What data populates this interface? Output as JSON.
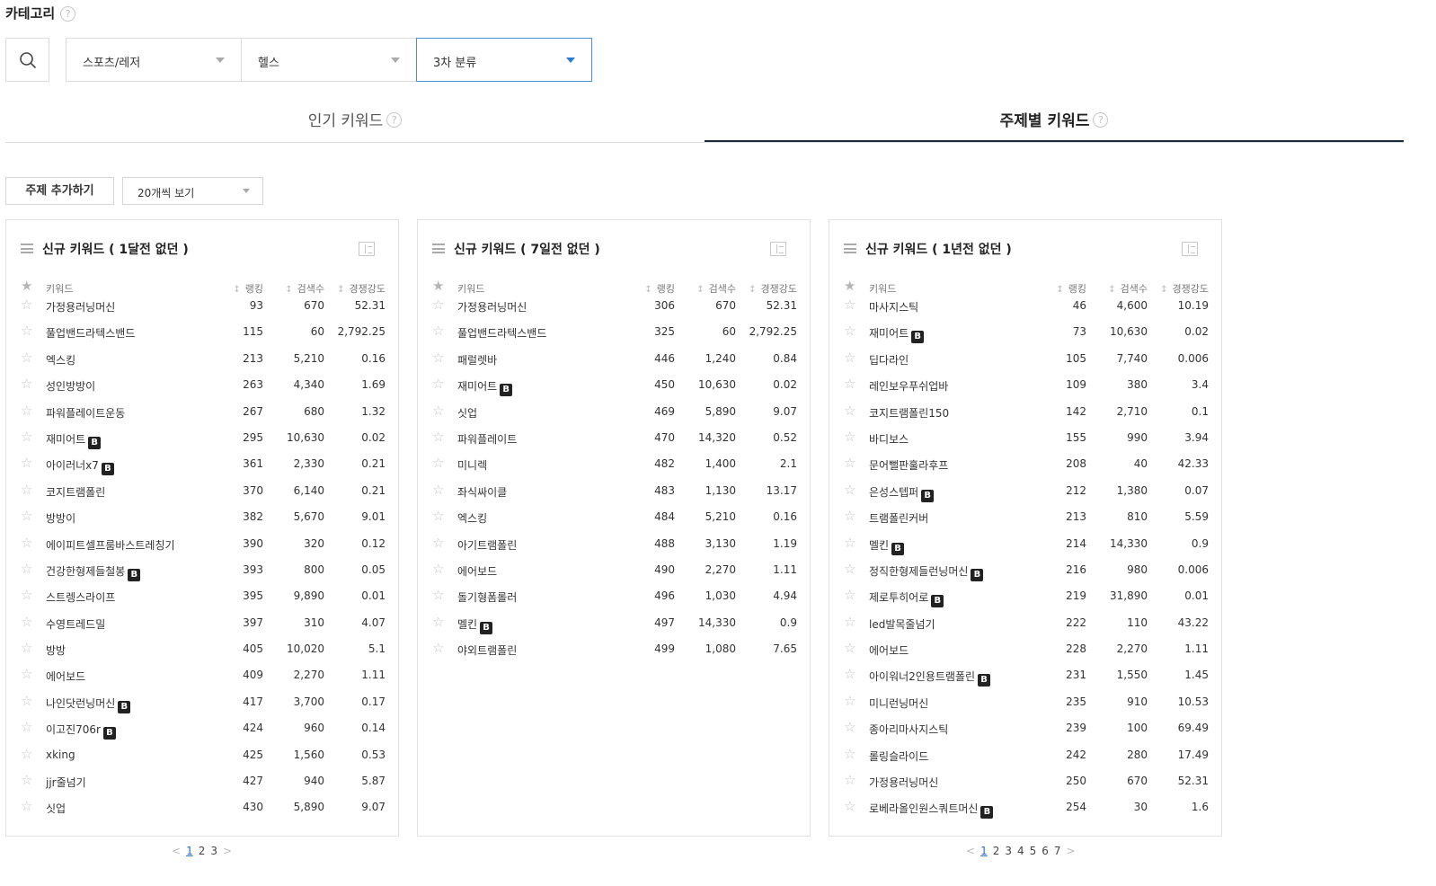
{
  "category": {
    "title": "카테고리",
    "help": "?"
  },
  "filters": {
    "first": "스포츠/레저",
    "second": "헬스",
    "third": "3차 분류"
  },
  "tabs": [
    {
      "label": "인기 키워드",
      "active": false
    },
    {
      "label": "주제별 키워드",
      "active": true
    }
  ],
  "toolbar": {
    "add_topic": "주제 추가하기",
    "view_count": "20개씩 보기"
  },
  "columns": {
    "keyword": "키워드",
    "rank": "랭킹",
    "search": "검색수",
    "competition": "경쟁강도"
  },
  "panels": [
    {
      "title": "신규 키워드 ( 1달전 없던 )",
      "rows": [
        {
          "kw": "가정용러닝머신",
          "b": false,
          "rank": "93",
          "search": "670",
          "comp": "52.31"
        },
        {
          "kw": "풀업밴드라텍스밴드",
          "b": false,
          "rank": "115",
          "search": "60",
          "comp": "2,792.25"
        },
        {
          "kw": "엑스킹",
          "b": false,
          "rank": "213",
          "search": "5,210",
          "comp": "0.16"
        },
        {
          "kw": "성인방방이",
          "b": false,
          "rank": "263",
          "search": "4,340",
          "comp": "1.69"
        },
        {
          "kw": "파워플레이트운동",
          "b": false,
          "rank": "267",
          "search": "680",
          "comp": "1.32"
        },
        {
          "kw": "재미어트",
          "b": true,
          "rank": "295",
          "search": "10,630",
          "comp": "0.02"
        },
        {
          "kw": "아이러너x7",
          "b": true,
          "rank": "361",
          "search": "2,330",
          "comp": "0.21"
        },
        {
          "kw": "코지트램폴린",
          "b": false,
          "rank": "370",
          "search": "6,140",
          "comp": "0.21"
        },
        {
          "kw": "방방이",
          "b": false,
          "rank": "382",
          "search": "5,670",
          "comp": "9.01"
        },
        {
          "kw": "에이피트셀프룸바스트레칭기",
          "b": false,
          "rank": "390",
          "search": "320",
          "comp": "0.12"
        },
        {
          "kw": "건강한형제들철봉",
          "b": true,
          "rank": "393",
          "search": "800",
          "comp": "0.05"
        },
        {
          "kw": "스트렝스라이프",
          "b": false,
          "rank": "395",
          "search": "9,890",
          "comp": "0.01"
        },
        {
          "kw": "수영트레드밀",
          "b": false,
          "rank": "397",
          "search": "310",
          "comp": "4.07"
        },
        {
          "kw": "방방",
          "b": false,
          "rank": "405",
          "search": "10,020",
          "comp": "5.1"
        },
        {
          "kw": "에어보드",
          "b": false,
          "rank": "409",
          "search": "2,270",
          "comp": "1.11"
        },
        {
          "kw": "나인닷런닝머신",
          "b": true,
          "rank": "417",
          "search": "3,700",
          "comp": "0.17"
        },
        {
          "kw": "이고진706r",
          "b": true,
          "rank": "424",
          "search": "960",
          "comp": "0.14"
        },
        {
          "kw": "xking",
          "b": false,
          "rank": "425",
          "search": "1,560",
          "comp": "0.53"
        },
        {
          "kw": "jjr줄넘기",
          "b": false,
          "rank": "427",
          "search": "940",
          "comp": "5.87"
        },
        {
          "kw": "싯업",
          "b": false,
          "rank": "430",
          "search": "5,890",
          "comp": "9.07"
        }
      ],
      "pager": {
        "prev": "<",
        "pages": [
          "1",
          "2",
          "3"
        ],
        "current": "1",
        "next": ">"
      }
    },
    {
      "title": "신규 키워드 ( 7일전 없던 )",
      "rows": [
        {
          "kw": "가정용러닝머신",
          "b": false,
          "rank": "306",
          "search": "670",
          "comp": "52.31"
        },
        {
          "kw": "풀업밴드라텍스밴드",
          "b": false,
          "rank": "325",
          "search": "60",
          "comp": "2,792.25"
        },
        {
          "kw": "패럴렛바",
          "b": false,
          "rank": "446",
          "search": "1,240",
          "comp": "0.84"
        },
        {
          "kw": "재미어트",
          "b": true,
          "rank": "450",
          "search": "10,630",
          "comp": "0.02"
        },
        {
          "kw": "싯업",
          "b": false,
          "rank": "469",
          "search": "5,890",
          "comp": "9.07"
        },
        {
          "kw": "파워플레이트",
          "b": false,
          "rank": "470",
          "search": "14,320",
          "comp": "0.52"
        },
        {
          "kw": "미니렉",
          "b": false,
          "rank": "482",
          "search": "1,400",
          "comp": "2.1"
        },
        {
          "kw": "좌식싸이클",
          "b": false,
          "rank": "483",
          "search": "1,130",
          "comp": "13.17"
        },
        {
          "kw": "엑스킹",
          "b": false,
          "rank": "484",
          "search": "5,210",
          "comp": "0.16"
        },
        {
          "kw": "아기트램폴린",
          "b": false,
          "rank": "488",
          "search": "3,130",
          "comp": "1.19"
        },
        {
          "kw": "에어보드",
          "b": false,
          "rank": "490",
          "search": "2,270",
          "comp": "1.11"
        },
        {
          "kw": "돌기형폼롤러",
          "b": false,
          "rank": "496",
          "search": "1,030",
          "comp": "4.94"
        },
        {
          "kw": "멜킨",
          "b": true,
          "rank": "497",
          "search": "14,330",
          "comp": "0.9"
        },
        {
          "kw": "야외트램폴린",
          "b": false,
          "rank": "499",
          "search": "1,080",
          "comp": "7.65"
        }
      ],
      "pager": null
    },
    {
      "title": "신규 키워드 ( 1년전 없던 )",
      "rows": [
        {
          "kw": "마사지스틱",
          "b": false,
          "rank": "46",
          "search": "4,600",
          "comp": "10.19"
        },
        {
          "kw": "재미어트",
          "b": true,
          "rank": "73",
          "search": "10,630",
          "comp": "0.02"
        },
        {
          "kw": "딥다라인",
          "b": false,
          "rank": "105",
          "search": "7,740",
          "comp": "0.006"
        },
        {
          "kw": "레인보우푸쉬업바",
          "b": false,
          "rank": "109",
          "search": "380",
          "comp": "3.4"
        },
        {
          "kw": "코지트램폴린150",
          "b": false,
          "rank": "142",
          "search": "2,710",
          "comp": "0.1"
        },
        {
          "kw": "바디보스",
          "b": false,
          "rank": "155",
          "search": "990",
          "comp": "3.94"
        },
        {
          "kw": "문어뻘판훌라후프",
          "b": false,
          "rank": "208",
          "search": "40",
          "comp": "42.33"
        },
        {
          "kw": "은성스텝퍼",
          "b": true,
          "rank": "212",
          "search": "1,380",
          "comp": "0.07"
        },
        {
          "kw": "트램폴린커버",
          "b": false,
          "rank": "213",
          "search": "810",
          "comp": "5.59"
        },
        {
          "kw": "멜킨",
          "b": true,
          "rank": "214",
          "search": "14,330",
          "comp": "0.9"
        },
        {
          "kw": "정직한형제들런닝머신",
          "b": true,
          "rank": "216",
          "search": "980",
          "comp": "0.006"
        },
        {
          "kw": "제로투히어로",
          "b": true,
          "rank": "219",
          "search": "31,890",
          "comp": "0.01"
        },
        {
          "kw": "led발목줄넘기",
          "b": false,
          "rank": "222",
          "search": "110",
          "comp": "43.22"
        },
        {
          "kw": "에어보드",
          "b": false,
          "rank": "228",
          "search": "2,270",
          "comp": "1.11"
        },
        {
          "kw": "아이워너2인용트램폴린",
          "b": true,
          "rank": "231",
          "search": "1,550",
          "comp": "1.45"
        },
        {
          "kw": "미니런닝머신",
          "b": false,
          "rank": "235",
          "search": "910",
          "comp": "10.53"
        },
        {
          "kw": "종아리마사지스틱",
          "b": false,
          "rank": "239",
          "search": "100",
          "comp": "69.49"
        },
        {
          "kw": "롤링슬라이드",
          "b": false,
          "rank": "242",
          "search": "280",
          "comp": "17.49"
        },
        {
          "kw": "가정용러닝머신",
          "b": false,
          "rank": "250",
          "search": "670",
          "comp": "52.31"
        },
        {
          "kw": "로베라올인원스쿼트머신",
          "b": true,
          "rank": "254",
          "search": "30",
          "comp": "1.6"
        }
      ],
      "pager": {
        "prev": "<",
        "pages": [
          "1",
          "2",
          "3",
          "4",
          "5",
          "6",
          "7"
        ],
        "current": "1",
        "next": ">"
      }
    }
  ],
  "badge_label": "B",
  "colors": {
    "accent": "#2a7ad6",
    "active_tab_border": "#1a2a3a",
    "badge_bg": "#222222"
  }
}
